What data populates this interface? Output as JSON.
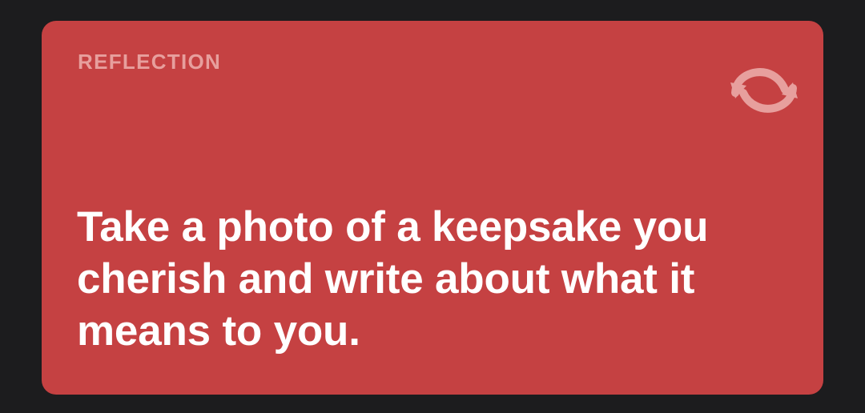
{
  "card": {
    "label": "REFLECTION",
    "prompt": "Take a photo of a keepsake you cherish and write about what it means to you.",
    "refresh_icon": "refresh-arrows-icon"
  },
  "colors": {
    "background": "#1c1c1e",
    "card": "#c54142",
    "label": "#e79f9d",
    "icon": "#e79f9d",
    "prompt": "#ffffff"
  }
}
